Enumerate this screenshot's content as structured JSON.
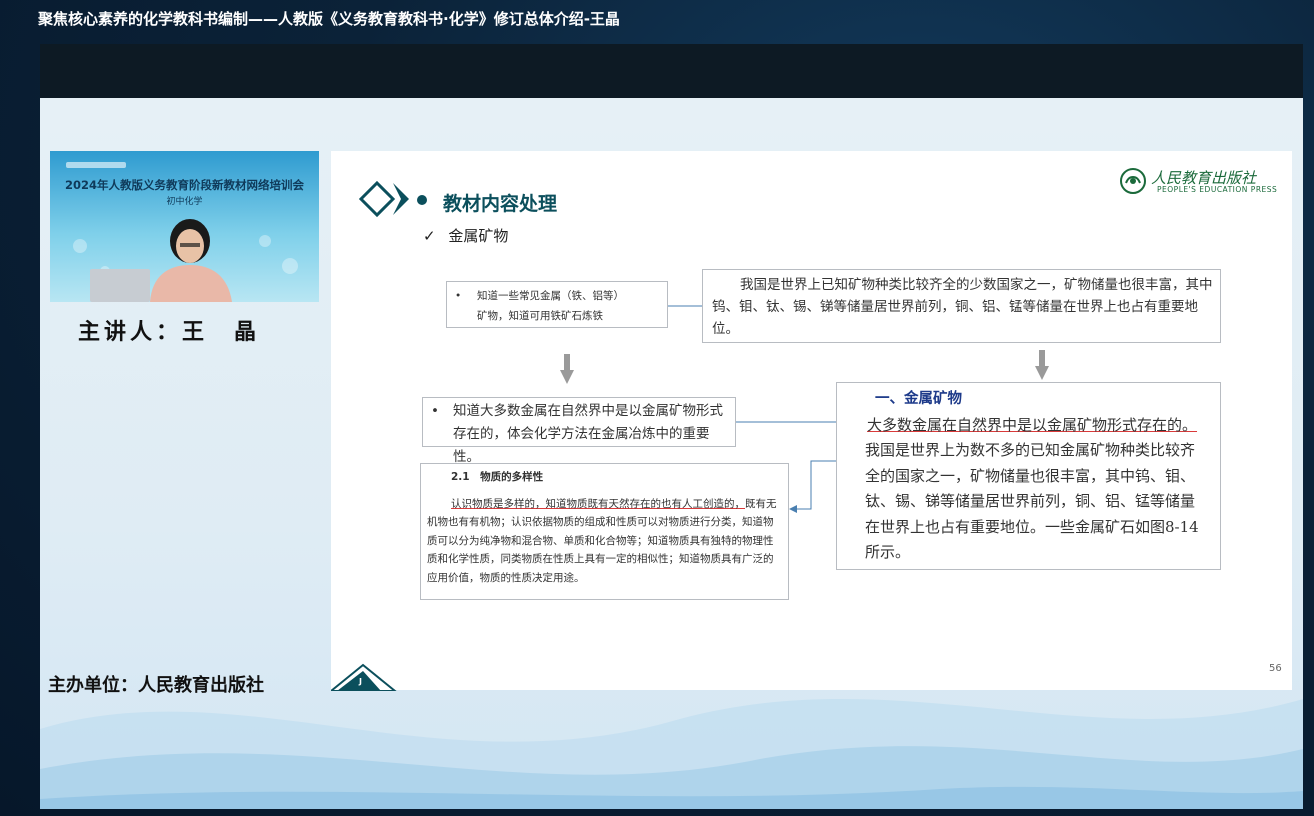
{
  "window": {
    "title": "聚焦核心素养的化学教科书编制——人教版《义务教育教科书·化学》修订总体介绍-王晶"
  },
  "speaker_panel": {
    "video_title": "2024年人教版义务教育阶段新教材网络培训会",
    "video_subtitle": "初中化学",
    "speaker_label": "主讲人：王　晶",
    "host_label": "主办单位：人民教育出版社"
  },
  "slide": {
    "section_title": "教材内容处理",
    "subtitle_check": "✓",
    "subtitle": "金属矿物",
    "logo_cn": "人民教育出版社",
    "logo_en": "PEOPLE'S EDUCATION PRESS",
    "box1": {
      "line1": "知道一些常见金属（铁、铝等）",
      "line2": "矿物，知道可用铁矿石炼铁"
    },
    "box2": {
      "text": "我国是世界上已知矿物种类比较齐全的少数国家之一，矿物储量也很丰富，其中钨、钼、钛、锡、锑等储量居世界前列，铜、铝、锰等储量在世界上也占有重要地位。"
    },
    "box3": {
      "line1": "知道大多数金属在自然界中是以金属矿物形式",
      "line2": "存在的，体会化学方法在金属冶炼中的重要性。"
    },
    "box4": {
      "title": "2.1　物质的多样性",
      "underlined": "认识物质是多样的，知道物质既有天然存在的也有人工创造的，",
      "rest": "既有无机物也有有机物；认识依据物质的组成和性质可以对物质进行分类，知道物质可以分为纯净物和混合物、单质和化合物等；知道物质具有独特的物理性质和化学性质，同类物质在性质上具有一定的相似性；知道物质具有广泛的应用价值，物质的性质决定用途。"
    },
    "box5": {
      "title": "一、金属矿物",
      "underlined": "大多数金属在自然界中是以金属矿物形式存在的。",
      "rest": "我国是世界上为数不多的已知金属矿物种类比较齐全的国家之一，矿物储量也很丰富，其中钨、钼、钛、锡、锑等储量居世界前列，铜、铝、锰等储量在世界上也占有重要地位。一些金属矿石如图8-14所示。"
    },
    "page_number": "56",
    "corner_letter": "J"
  },
  "colors": {
    "title_teal": "#0b4f5c",
    "heading_blue": "#1d3a8a",
    "underline_red": "#d93a3a",
    "connector_blue": "#4a7fb0",
    "arrow_gray": "#9a9a9a"
  }
}
